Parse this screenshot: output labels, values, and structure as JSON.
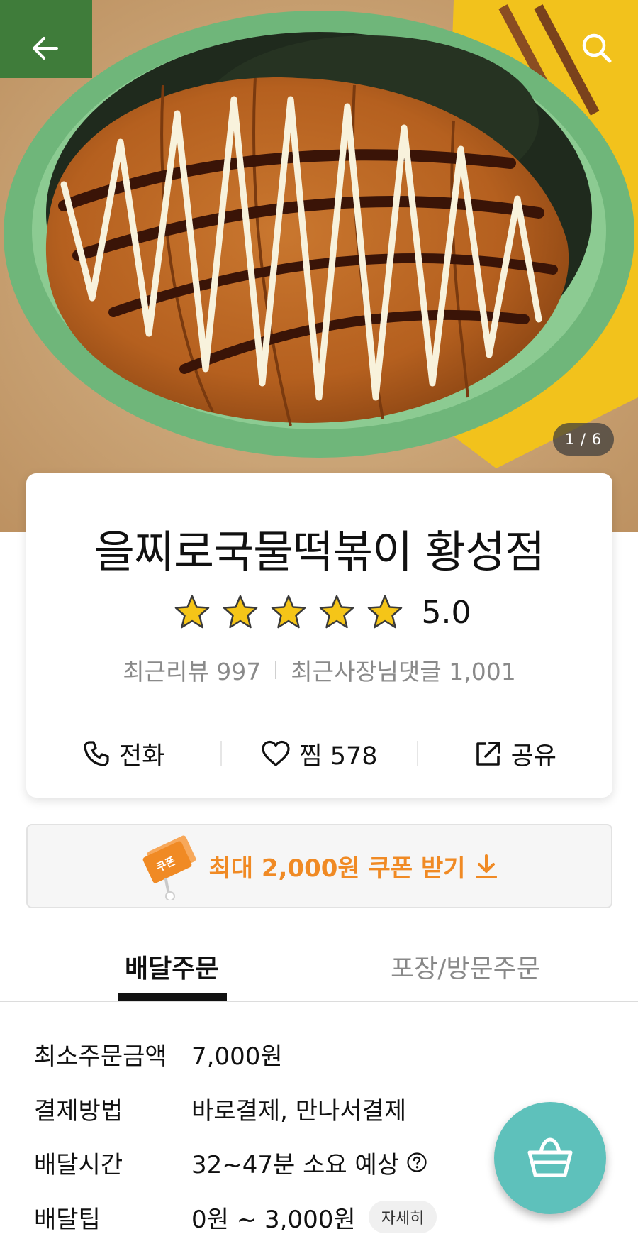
{
  "hero": {
    "image_counter": "1 / 6"
  },
  "store": {
    "name": "을찌로국물떡볶이 황성점",
    "rating": "5.0",
    "stars_filled": 5,
    "stars_total": 5,
    "recent_reviews": "최근리뷰 997",
    "owner_replies": "최근사장님댓글 1,001"
  },
  "actions": {
    "call_label": "전화",
    "favorite_label": "찜 578",
    "share_label": "공유"
  },
  "coupon": {
    "badge_text": "쿠폰",
    "label": "최대 2,000원 쿠폰 받기"
  },
  "tabs": {
    "delivery": "배달주문",
    "pickup": "포장/방문주문",
    "active": "delivery"
  },
  "details": {
    "min_order_label": "최소주문금액",
    "min_order_value": "7,000원",
    "payment_label": "결제방법",
    "payment_value": "바로결제, 만나서결제",
    "delivery_time_label": "배달시간",
    "delivery_time_value": "32~47분 소요 예상",
    "delivery_tip_label": "배달팁",
    "delivery_tip_value": "0원 ~ 3,000원",
    "more_button": "자세히"
  },
  "icons": {
    "back": "arrow-left-icon",
    "search": "search-icon",
    "call": "phone-icon",
    "favorite": "heart-icon",
    "share": "share-icon",
    "coupon_download": "download-icon",
    "help": "question-circle-icon",
    "cart": "basket-icon"
  },
  "colors": {
    "accent_orange": "#f08a24",
    "cart_teal": "#5ec1bb",
    "star_gold": "#f5c518"
  }
}
